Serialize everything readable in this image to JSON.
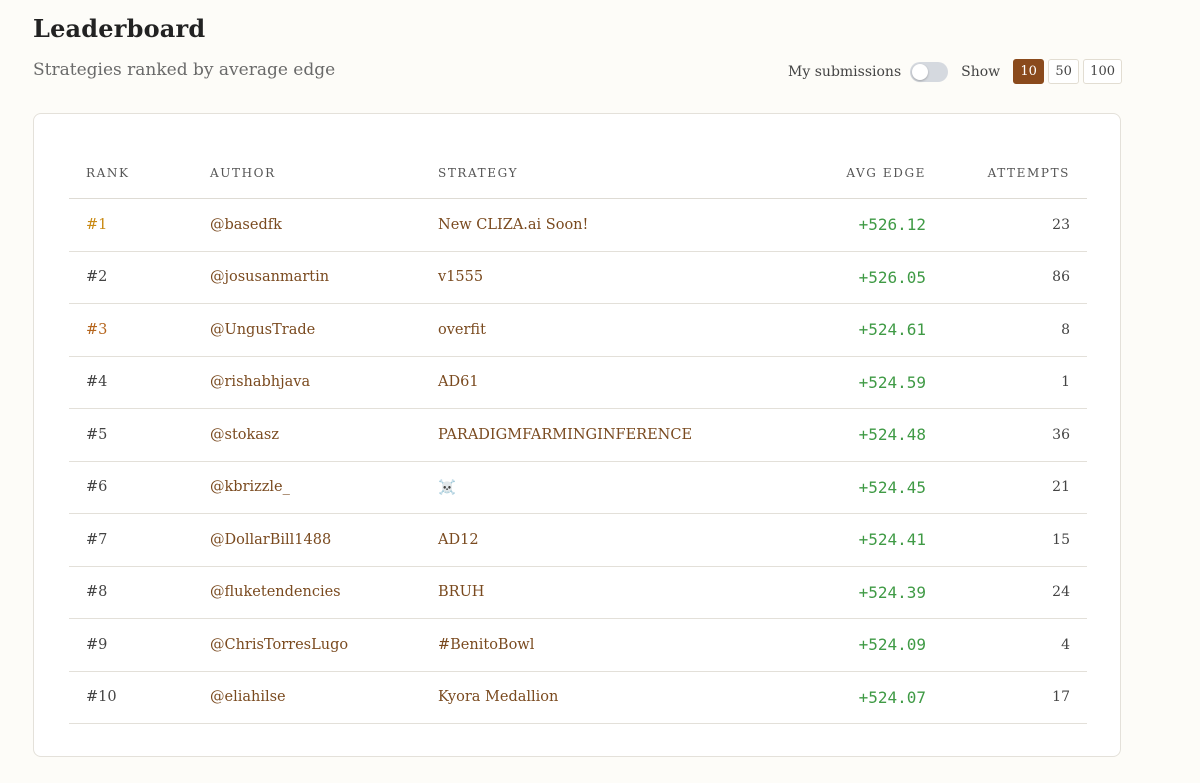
{
  "header": {
    "title": "Leaderboard",
    "subtitle": "Strategies ranked by average edge"
  },
  "controls": {
    "my_submissions_label": "My submissions",
    "my_submissions_enabled": false,
    "show_label": "Show",
    "page_sizes": [
      "10",
      "50",
      "100"
    ],
    "selected_page_size": "10",
    "accent_color": "#8a4a1c"
  },
  "table": {
    "columns": [
      "RANK",
      "AUTHOR",
      "STRATEGY",
      "AVG EDGE",
      "ATTEMPTS"
    ],
    "rows": [
      {
        "rank": "#1",
        "author": "@basedfk",
        "strategy": "New CLIZA.ai Soon!",
        "avg_edge": "+526.12",
        "attempts": "23"
      },
      {
        "rank": "#2",
        "author": "@josusanmartin",
        "strategy": "v1555",
        "avg_edge": "+526.05",
        "attempts": "86"
      },
      {
        "rank": "#3",
        "author": "@UngusTrade",
        "strategy": "overfit",
        "avg_edge": "+524.61",
        "attempts": "8"
      },
      {
        "rank": "#4",
        "author": "@rishabhjava",
        "strategy": "AD61",
        "avg_edge": "+524.59",
        "attempts": "1"
      },
      {
        "rank": "#5",
        "author": "@stokasz",
        "strategy": "PARADIGMFARMINGINFERENCE",
        "avg_edge": "+524.48",
        "attempts": "36"
      },
      {
        "rank": "#6",
        "author": "@kbrizzle_",
        "strategy": "☠️",
        "avg_edge": "+524.45",
        "attempts": "21"
      },
      {
        "rank": "#7",
        "author": "@DollarBill1488",
        "strategy": "AD12",
        "avg_edge": "+524.41",
        "attempts": "15"
      },
      {
        "rank": "#8",
        "author": "@fluketendencies",
        "strategy": "BRUH",
        "avg_edge": "+524.39",
        "attempts": "24"
      },
      {
        "rank": "#9",
        "author": "@ChrisTorresLugo",
        "strategy": "#BenitoBowl",
        "avg_edge": "+524.09",
        "attempts": "4"
      },
      {
        "rank": "#10",
        "author": "@eliahilse",
        "strategy": "Kyora Medallion",
        "avg_edge": "+524.07",
        "attempts": "17"
      }
    ],
    "colors": {
      "rank_1": "#c98a14",
      "rank_3": "#b5651d",
      "edge_positive": "#3f9a45",
      "link": "#7a4a1f"
    }
  }
}
